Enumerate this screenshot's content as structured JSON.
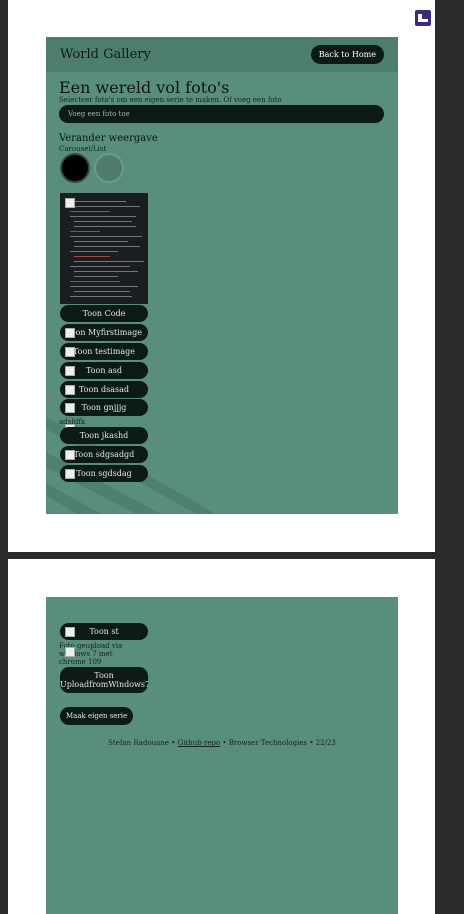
{
  "app": {
    "brand": "World Gallery",
    "back_button": "Back to Home"
  },
  "intro": {
    "heading": "Een wereld vol foto's",
    "subtitle": "Selecteer foto's om een eigen serie te maken. Of voeg een foto",
    "add_photo_placeholder": "Voeg een foto toe"
  },
  "view": {
    "heading": "Verander weergave",
    "mode_label": "Carousel/List"
  },
  "photos": [
    {
      "label": "Toon Code"
    },
    {
      "label": "Toon Myfirstimage"
    },
    {
      "label": "Toon testimage"
    },
    {
      "label": "Toon asd"
    },
    {
      "label": "Toon dsasad"
    },
    {
      "label": "Toon gnjjjg"
    },
    {
      "label": "Toon jkashd"
    },
    {
      "label": "Toon sdgsadgd"
    },
    {
      "label": "Toon sgdsdag"
    },
    {
      "label": "Toon st"
    },
    {
      "label": "Toon UploadfromWindows7"
    }
  ],
  "notes": {
    "small_note": "adsfdfk",
    "upload_note": "Foto geupload via windows 7 met chrome 109"
  },
  "actions": {
    "make_series": "Maak eigen serie"
  },
  "footer": {
    "author": "Stefan Radouane",
    "sep1": " • ",
    "link": "Github repo",
    "sep2": " • ",
    "course": "Browser Technologies • 22/23"
  },
  "colors": {
    "panel": "#5a8e7c",
    "header": "#4d7e6d",
    "button": "#0d1a15",
    "corner_icon": "#3b2b7c"
  },
  "icons": {
    "corner": "panel-toggle-icon"
  }
}
